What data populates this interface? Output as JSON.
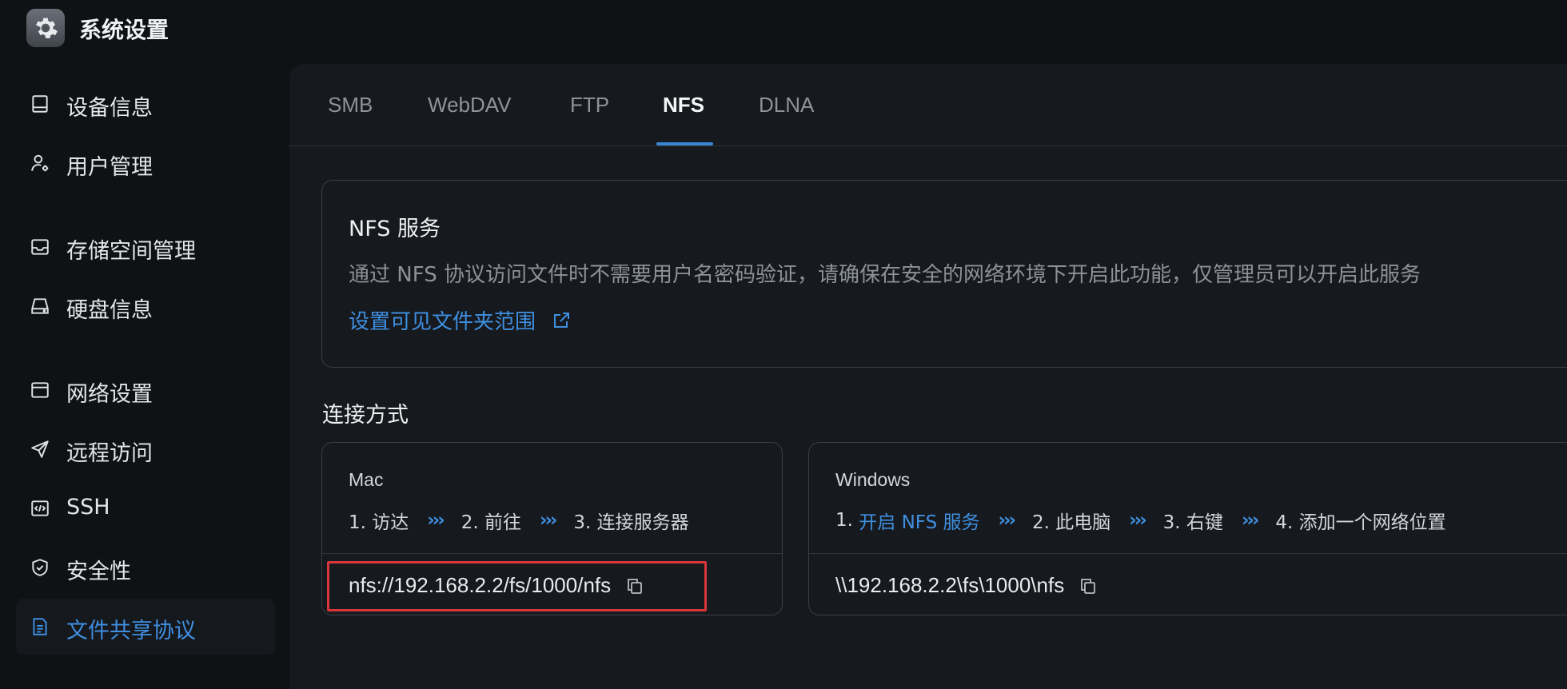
{
  "app": {
    "title": "系统设置",
    "icon": "gear-icon"
  },
  "sidebar": {
    "items": [
      {
        "label": "设备信息",
        "icon": "device-icon"
      },
      {
        "label": "用户管理",
        "icon": "user-settings-icon"
      },
      {
        "label": "存储空间管理",
        "icon": "storage-icon"
      },
      {
        "label": "硬盘信息",
        "icon": "disk-icon"
      },
      {
        "label": "网络设置",
        "icon": "network-icon"
      },
      {
        "label": "远程访问",
        "icon": "send-icon"
      },
      {
        "label": "SSH",
        "icon": "code-icon"
      },
      {
        "label": "安全性",
        "icon": "shield-icon"
      },
      {
        "label": "文件共享协议",
        "icon": "document-icon",
        "active": true
      }
    ]
  },
  "tabs": [
    {
      "label": "SMB"
    },
    {
      "label": "WebDAV"
    },
    {
      "label": "FTP"
    },
    {
      "label": "NFS",
      "active": true
    },
    {
      "label": "DLNA"
    }
  ],
  "service": {
    "title": "NFS 服务",
    "description": "通过 NFS 协议访问文件时不需要用户名密码验证，请确保在安全的网络环境下开启此功能，仅管理员可以开启此服务",
    "link_label": "设置可见文件夹范围"
  },
  "connection": {
    "title": "连接方式",
    "mac": {
      "os": "Mac",
      "steps": [
        "1. 访达",
        "2. 前往",
        "3. 连接服务器"
      ],
      "address": "nfs://192.168.2.2/fs/1000/nfs"
    },
    "windows": {
      "os": "Windows",
      "step1_prefix": "1. ",
      "step1_link": "开启 NFS 服务",
      "steps": [
        "2. 此电脑",
        "3. 右键",
        "4. 添加一个网络位置"
      ],
      "address": "\\\\192.168.2.2\\fs\\1000\\nfs"
    }
  },
  "colors": {
    "accent": "#3f8fe0",
    "highlight": "#d8363b",
    "background": "#0f1114",
    "panel": "#16191d"
  }
}
